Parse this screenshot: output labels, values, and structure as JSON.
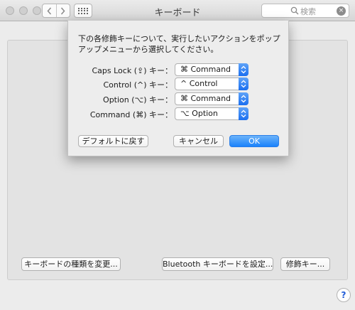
{
  "window": {
    "title": "キーボード",
    "search_placeholder": "検索",
    "back_glyph": "‹",
    "forward_glyph": "›",
    "clear_glyph": "×"
  },
  "main": {
    "change_type_button": "キーボードの種類を変更...",
    "bluetooth_button": "Bluetooth キーボードを設定...",
    "modifier_button": "修飾キー...",
    "help_glyph": "?"
  },
  "sheet": {
    "message": "下の各修飾キーについて、実行したいアクションをポップアップメニューから選択してください。",
    "mappings": [
      {
        "label": "Caps Lock (⇪) キー：",
        "value": "⌘ Command"
      },
      {
        "label": "Control (^) キー：",
        "value": "^ Control"
      },
      {
        "label": "Option (⌥) キー：",
        "value": "⌘ Command"
      },
      {
        "label": "Command (⌘) キー：",
        "value": "⌥ Option"
      }
    ],
    "defaults_button": "デフォルトに戻す",
    "cancel_button": "キャンセル",
    "ok_button": "OK"
  },
  "colors": {
    "accent": "#1a82fb",
    "help": "#1f5bd8"
  },
  "icons": {
    "search": "search-icon",
    "grid": "show-all-grid-icon",
    "stepper": "popup-stepper-icon"
  }
}
